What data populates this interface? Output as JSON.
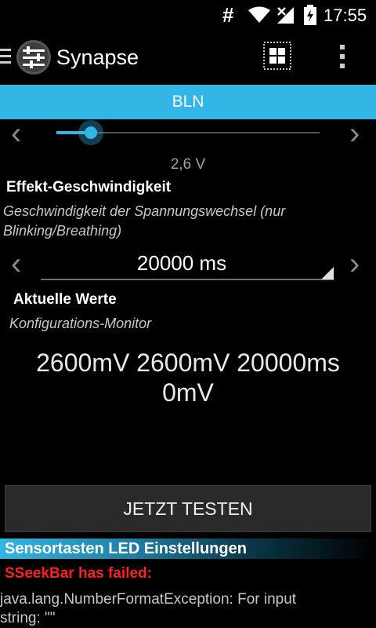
{
  "status_bar": {
    "hash_symbol": "#",
    "time": "17:55",
    "icons": [
      "wifi-icon",
      "signal-icon",
      "battery-charging-icon"
    ]
  },
  "action_bar": {
    "app_title": "Synapse",
    "icons": [
      "drawer-menu-icon",
      "app-equalizer-icon",
      "grid-view-icon",
      "overflow-menu-icon"
    ]
  },
  "section": {
    "title": "BLN",
    "accent_color": "#33b5e5"
  },
  "voltage_slider": {
    "value_text": "2,6 V",
    "fill_fraction": 0.13
  },
  "effect_speed": {
    "title": "Effekt-Geschwindigkeit",
    "summary_line1": "Geschwindigkeit der Spannungswechsel (nur",
    "summary_line2": "Blinking/Breathing)",
    "spinner_value": "20000 ms"
  },
  "current_values": {
    "title": "Aktuelle Werte",
    "summary": "Konfigurations-Monitor",
    "line1": "2600mV 2600mV 20000ms",
    "line2": "0mV"
  },
  "test_button": {
    "label": "JETZT TESTEN"
  },
  "led_section": {
    "title": "Sensortasten LED Einstellungen"
  },
  "error": {
    "title": "SSeekBar has failed:",
    "line1": "java.lang.NumberFormatException: For input",
    "line2": "string: \"\""
  }
}
